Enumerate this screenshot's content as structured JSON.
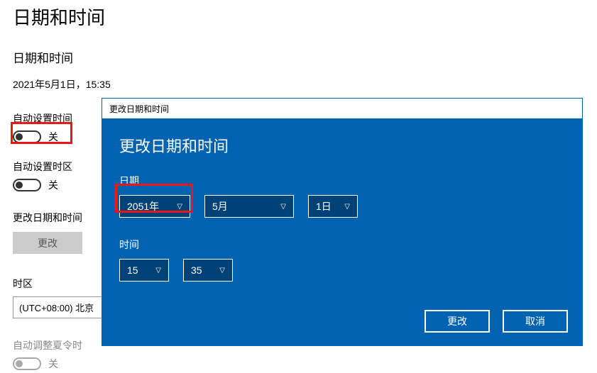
{
  "main": {
    "title": "日期和时间",
    "sub_title": "日期和时间",
    "current_datetime": "2021年5月1日，15:35",
    "auto_time_label": "自动设置时间",
    "auto_time_state": "关",
    "auto_tz_label": "自动设置时区",
    "auto_tz_state": "关",
    "change_datetime_label": "更改日期和时间",
    "change_button": "更改",
    "tz_label": "时区",
    "tz_value": "(UTC+08:00) 北京",
    "dst_label": "自动调整夏令时",
    "dst_state": "关"
  },
  "dialog": {
    "titlebar": "更改日期和时间",
    "heading": "更改日期和时间",
    "date_label": "日期",
    "year": "2051年",
    "month": "5月",
    "day": "1日",
    "time_label": "时间",
    "hour": "15",
    "minute": "35",
    "change_btn": "更改",
    "cancel_btn": "取消"
  }
}
